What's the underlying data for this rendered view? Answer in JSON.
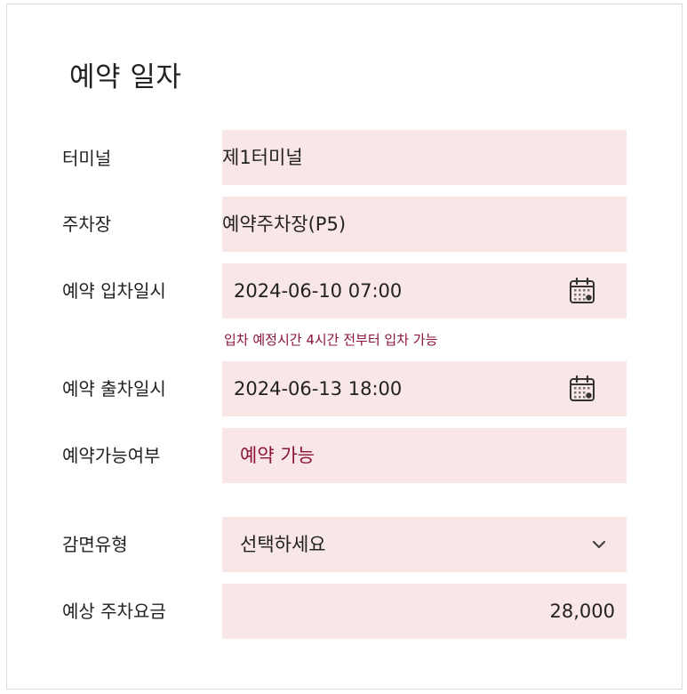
{
  "section": {
    "title": "예약 일자"
  },
  "form": {
    "terminal": {
      "label": "터미널",
      "value": "제1터미널"
    },
    "parking_lot": {
      "label": "주차장",
      "value": "예약주차장(P5)"
    },
    "entry_datetime": {
      "label": "예약 입차일시",
      "value": "2024-06-10 07:00",
      "icon": "calendar-icon"
    },
    "entry_hint": "입차 예정시간 4시간 전부터 입차 가능",
    "exit_datetime": {
      "label": "예약 출차일시",
      "value": "2024-06-13 18:00",
      "icon": "calendar-icon"
    },
    "availability": {
      "label": "예약가능여부",
      "value": "예약 가능"
    },
    "discount_type": {
      "label": "감면유형",
      "value": "선택하세요",
      "icon": "chevron-down-icon"
    },
    "estimated_fee": {
      "label": "예상 주차요금",
      "value": "28,000"
    }
  },
  "colors": {
    "field_bg": "#f9e6e6",
    "accent": "#8b1538",
    "border": "#dcdcdc"
  }
}
